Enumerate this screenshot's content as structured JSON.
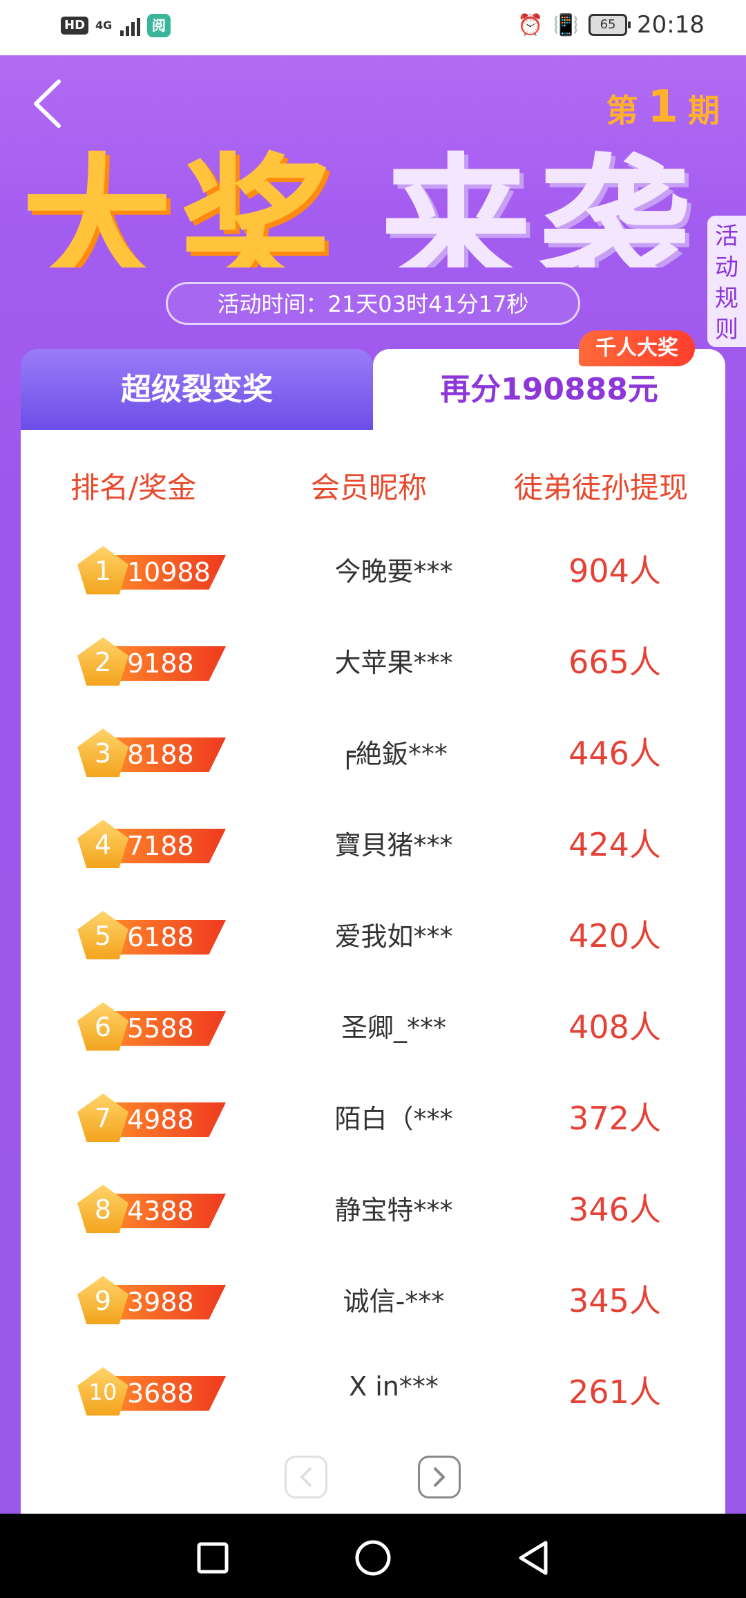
{
  "status_bar": {
    "network": "4G",
    "hd": "HD",
    "app_badge": "阅",
    "battery": "65",
    "time": "20:18"
  },
  "header": {
    "period_prefix": "第",
    "period_number": "1",
    "period_suffix": "期",
    "banner_left": "大奖",
    "banner_right": "来袭",
    "rules_label": "活动规则",
    "timer_text": "活动时间：21天03时41分17秒"
  },
  "tabs": {
    "left": "超级裂变奖",
    "right": "再分190888元",
    "badge": "千人大奖"
  },
  "table": {
    "headers": [
      "排名/奖金",
      "会员昵称",
      "徒弟徒孙提现"
    ],
    "rows": [
      {
        "rank": "1",
        "prize": "10988",
        "nickname": "今晚要***",
        "count": "904人"
      },
      {
        "rank": "2",
        "prize": "9188",
        "nickname": "大苹果***",
        "count": "665人"
      },
      {
        "rank": "3",
        "prize": "8188",
        "nickname": "╒絶鈑***",
        "count": "446人"
      },
      {
        "rank": "4",
        "prize": "7188",
        "nickname": "寶貝猪***",
        "count": "424人"
      },
      {
        "rank": "5",
        "prize": "6188",
        "nickname": "爱我如***",
        "count": "420人"
      },
      {
        "rank": "6",
        "prize": "5588",
        "nickname": "圣卿_***",
        "count": "408人"
      },
      {
        "rank": "7",
        "prize": "4988",
        "nickname": "陌白（***",
        "count": "372人"
      },
      {
        "rank": "8",
        "prize": "4388",
        "nickname": "静宝特***",
        "count": "346人"
      },
      {
        "rank": "9",
        "prize": "3988",
        "nickname": "诚信-***",
        "count": "345人"
      },
      {
        "rank": "10",
        "prize": "3688",
        "nickname": "X in***",
        "count": "261人"
      }
    ]
  },
  "colors": {
    "accent_purple": "#9b59ea",
    "rank_orange": "#e8482b",
    "count_red": "#e54236"
  }
}
